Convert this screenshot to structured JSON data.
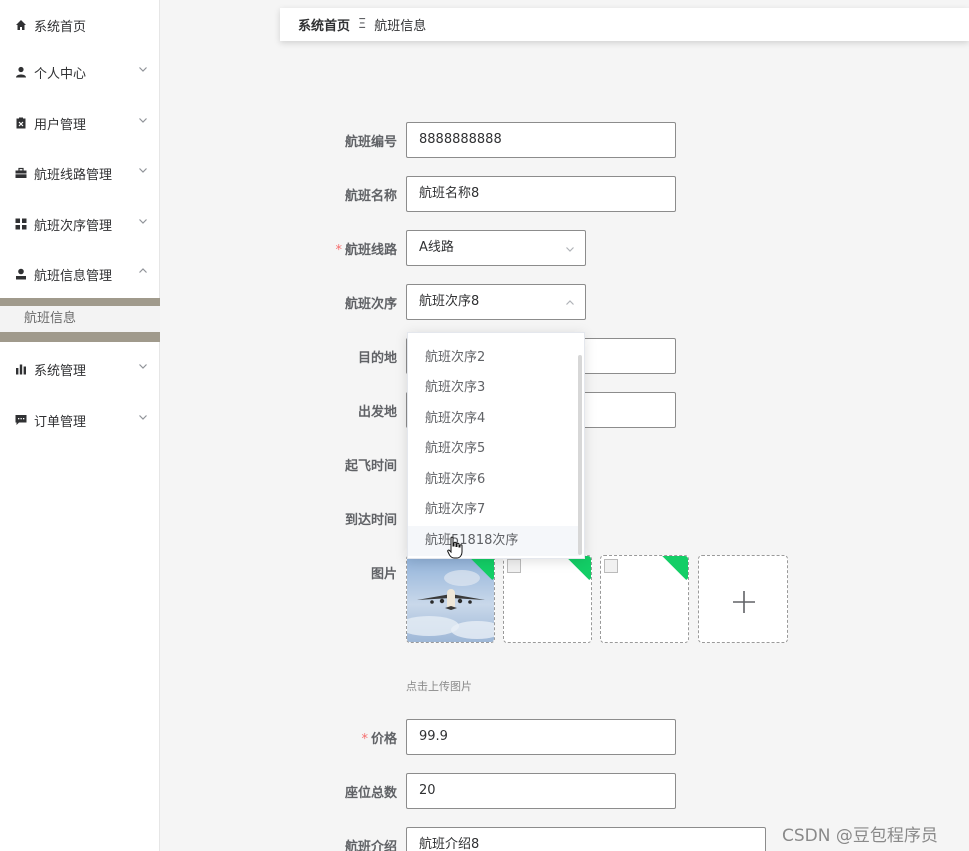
{
  "sidebar": {
    "items": [
      {
        "label": "系统首页",
        "icon": "home-icon"
      },
      {
        "label": "个人中心",
        "icon": "user-icon"
      },
      {
        "label": "用户管理",
        "icon": "clipboard-icon"
      },
      {
        "label": "航班线路管理",
        "icon": "briefcase-icon"
      },
      {
        "label": "航班次序管理",
        "icon": "grid-icon"
      },
      {
        "label": "航班信息管理",
        "icon": "person-icon"
      },
      {
        "label": "系统管理",
        "icon": "bar-chart-icon"
      },
      {
        "label": "订单管理",
        "icon": "chat-icon"
      }
    ],
    "active_sub": "航班信息"
  },
  "breadcrumb": {
    "home": "系统首页",
    "separator": "Ξ",
    "current": "航班信息"
  },
  "form": {
    "flight_no_label": "航班编号",
    "flight_no_value": "8888888888",
    "flight_name_label": "航班名称",
    "flight_name_value": "航班名称8",
    "route_label": "航班线路",
    "route_value": "A线路",
    "sequence_label": "航班次序",
    "sequence_value": "航班次序8",
    "destination_label": "目的地",
    "origin_label": "出发地",
    "depart_label": "起飞时间",
    "arrive_label": "到达时间",
    "image_label": "图片",
    "upload_hint": "点击上传图片",
    "price_label": "价格",
    "price_value": "99.9",
    "seats_label": "座位总数",
    "seats_value": "20",
    "intro_label": "航班介绍",
    "intro_value": "航班介绍8",
    "required_mark": "*"
  },
  "dropdown": {
    "options": [
      "航班次序2",
      "航班次序3",
      "航班次序4",
      "航班次序5",
      "航班次序6",
      "航班次序7",
      "航班51818次序"
    ]
  },
  "watermark": "CSDN @豆包程序员",
  "colors": {
    "required": "#f56c6c",
    "corner_badge": "#13ce66",
    "sidebar_active_band": "#a09a8c"
  }
}
